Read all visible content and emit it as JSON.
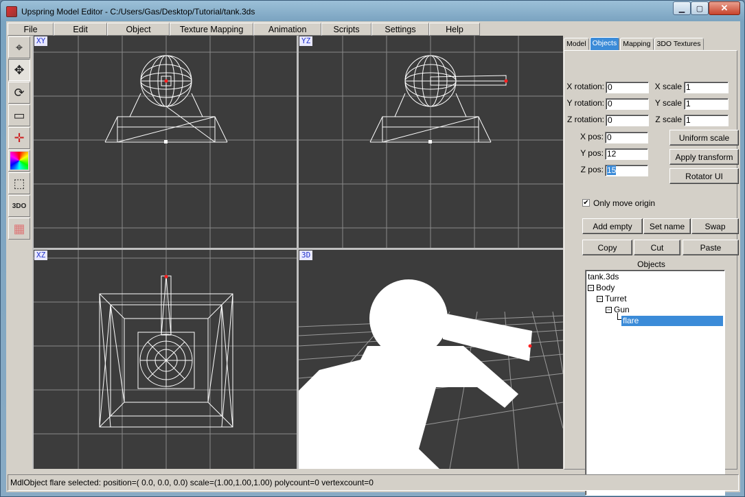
{
  "window": {
    "title": "Upspring Model Editor - C:/Users/Gas/Desktop/Tutorial/tank.3ds",
    "minimize": "▁",
    "maximize": "▢",
    "close": "✕"
  },
  "menu": [
    "File",
    "Edit",
    "Object",
    "Texture Mapping",
    "Animation",
    "Scripts",
    "Settings",
    "Help"
  ],
  "toolbar": [
    {
      "name": "camera-tool",
      "icon": "⌖"
    },
    {
      "name": "move-tool",
      "icon": "✥"
    },
    {
      "name": "rotate-tool",
      "icon": "⟳"
    },
    {
      "name": "scale-tool",
      "icon": "▭"
    },
    {
      "name": "origin-move-tool",
      "icon": "✛"
    },
    {
      "name": "color-tool",
      "icon": ""
    },
    {
      "name": "texture-cube-tool",
      "icon": "⬚"
    },
    {
      "name": "3do-tool",
      "icon": "3DO"
    },
    {
      "name": "texture-paint-tool",
      "icon": "▦"
    }
  ],
  "viewports": {
    "xy": "XY",
    "yz": "YZ",
    "xz": "XZ",
    "persp": "3D"
  },
  "tabs": [
    "Model",
    "Objects",
    "Mapping",
    "3DO Textures"
  ],
  "active_tab": "Objects",
  "transform": {
    "x_rotation_label": "X rotation:",
    "x_rotation": "0",
    "y_rotation_label": "Y rotation:",
    "y_rotation": "0",
    "z_rotation_label": "Z rotation:",
    "z_rotation": "0",
    "x_scale_label": "X scale",
    "x_scale": "1",
    "y_scale_label": "Y scale",
    "y_scale": "1",
    "z_scale_label": "Z scale",
    "z_scale": "1",
    "x_pos_label": "X pos:",
    "x_pos": "0",
    "y_pos_label": "Y pos:",
    "y_pos": "12",
    "z_pos_label": "Z pos:",
    "z_pos": "15",
    "uniform_scale": "Uniform scale",
    "apply_transform": "Apply transform",
    "rotator_ui": "Rotator UI",
    "only_move_origin": "Only move origin",
    "only_move_origin_checked": "✔"
  },
  "actions": {
    "add_empty": "Add empty",
    "set_name": "Set name",
    "swap": "Swap",
    "copy": "Copy",
    "cut": "Cut",
    "paste": "Paste"
  },
  "objects": {
    "title": "Objects",
    "tree": [
      {
        "label": "tank.3ds",
        "depth": 0,
        "toggle": ""
      },
      {
        "label": "Body",
        "depth": 0,
        "toggle": "−"
      },
      {
        "label": "Turret",
        "depth": 1,
        "toggle": "−"
      },
      {
        "label": "Gun",
        "depth": 2,
        "toggle": "−"
      },
      {
        "label": "flare",
        "depth": 3,
        "toggle": "",
        "selected": true
      }
    ]
  },
  "status": "MdlObject flare selected: position=( 0.0, 0.0, 0.0) scale=(1.00,1.00,1.00) polycount=0 vertexcount=0",
  "colors": {
    "selection": "#3b8bd8",
    "viewport_bg": "#3c3c3c",
    "wire": "#ffffff",
    "marker": "#ff2020"
  }
}
